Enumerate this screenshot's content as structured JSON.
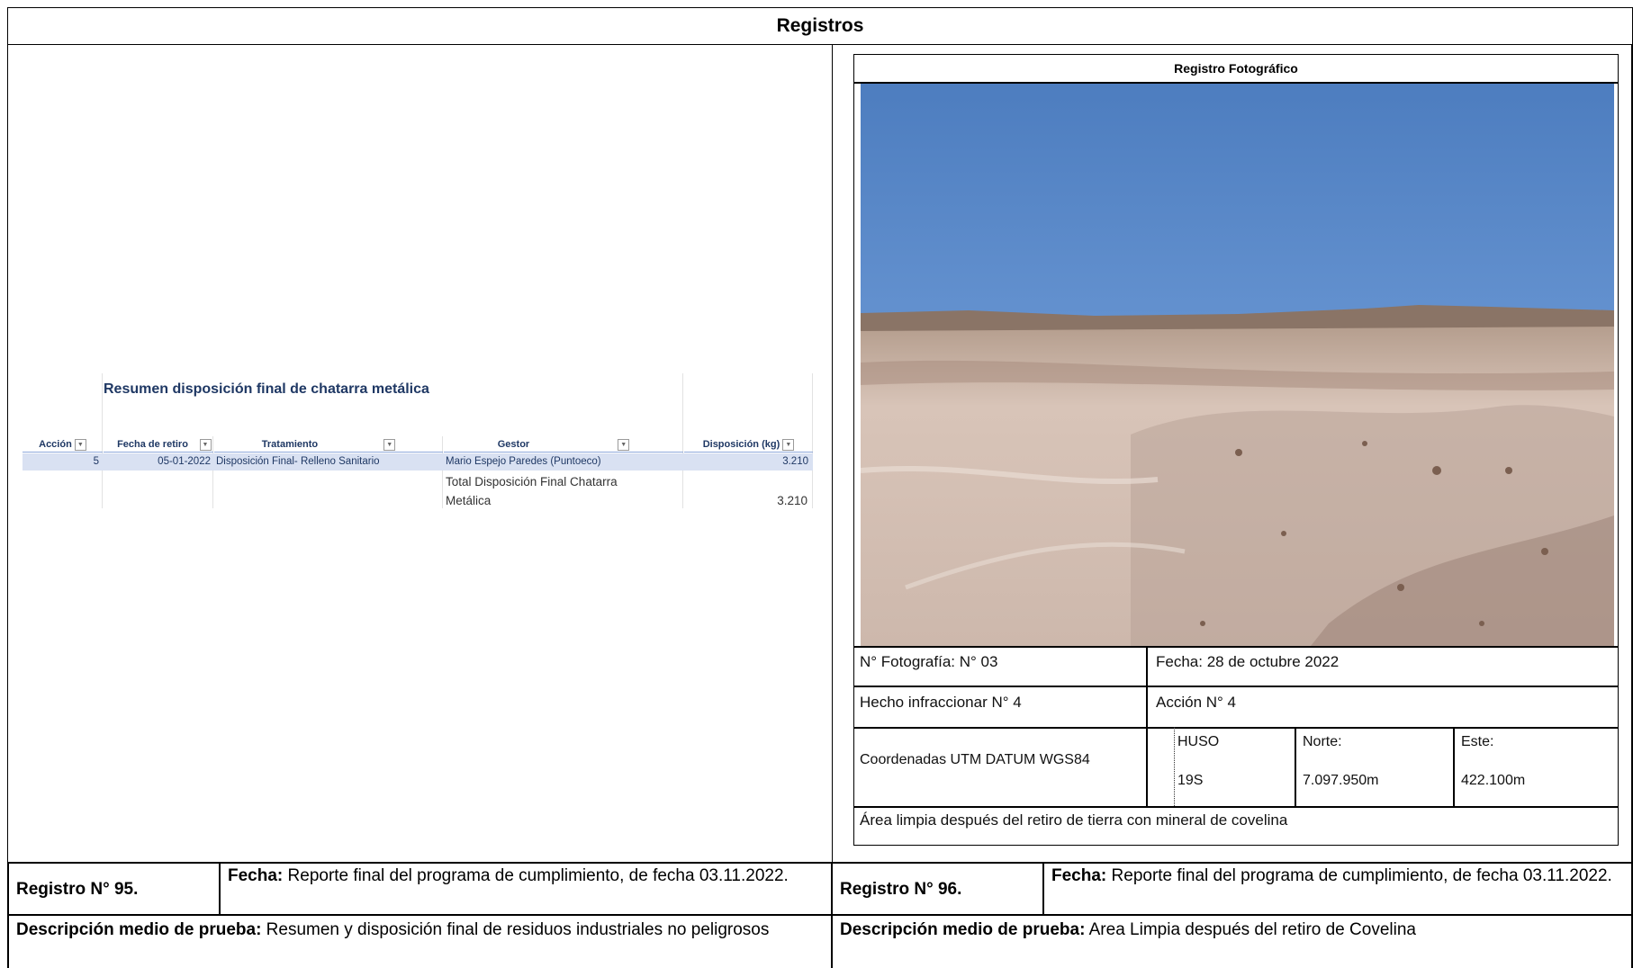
{
  "title": "Registros",
  "left": {
    "excel": {
      "title": "Resumen  disposición final de chatarra metálica",
      "headers": [
        "Acción",
        "Fecha de retiro",
        "Tratamiento",
        "Gestor",
        "Disposición (kg)"
      ],
      "row": {
        "accion": "5",
        "fecha": "05-01-2022",
        "tratamiento": "Disposición Final- Relleno Sanitario",
        "gestor": "Mario Espejo Paredes (Puntoeco)",
        "disposicion": "3.210"
      },
      "total_label_1": "Total  Disposición Final Chatarra",
      "total_label_2": "Metálica",
      "total_value": "3.210"
    },
    "registro": "Registro N° 95.",
    "fecha_label": "Fecha:",
    "fecha_text": " Reporte final del programa de cumplimiento, de fecha 03.11.2022.",
    "desc_label": "Descripción medio de prueba:",
    "desc_text": " Resumen y disposición final de residuos  industriales no peligrosos"
  },
  "right": {
    "photo_record": {
      "header": "Registro Fotográfico",
      "foto_no": "N° Fotografía: N° 03",
      "fecha": "Fecha:  28 de octubre 2022",
      "hecho": "Hecho infraccionar N° 4",
      "accion": "Acción N° 4",
      "coord_label": "Coordenadas UTM DATUM WGS84",
      "huso_label": "HUSO",
      "huso_value": "19S",
      "norte_label": "Norte:",
      "norte_value": "7.097.950m",
      "este_label": "Este:",
      "este_value": "422.100m",
      "caption": "Área limpia después del retiro de tierra con mineral de covelina"
    },
    "registro": "Registro N° 96.",
    "fecha_label": "Fecha:",
    "fecha_text": " Reporte final del programa de cumplimiento, de fecha 03.11.2022.",
    "desc_label": "Descripción medio de prueba:",
    "desc_text": " Area Limpia después del retiro de Covelina"
  }
}
